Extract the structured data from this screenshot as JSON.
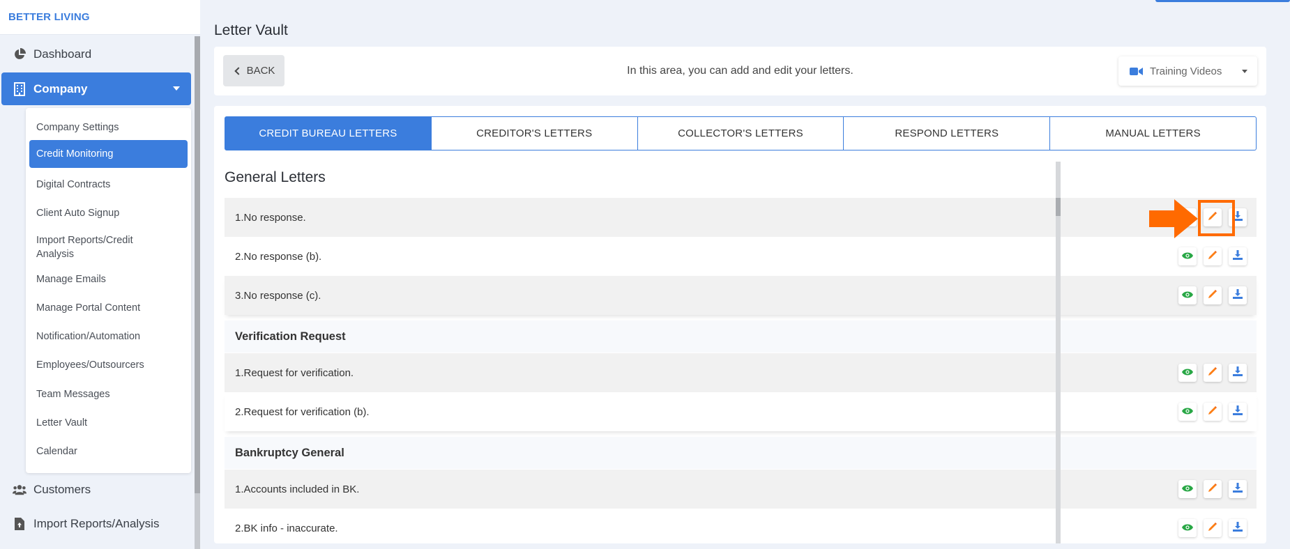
{
  "brand": "BETTER LIVING",
  "sidebar": {
    "dashboard": "Dashboard",
    "company": "Company",
    "submenu": [
      "Company Settings",
      "Credit Monitoring",
      "Digital Contracts",
      "Client Auto Signup",
      "Import Reports/Credit Analysis",
      "Manage Emails",
      "Manage Portal Content",
      "Notification/Automation",
      "Employees/Outsourcers",
      "Team Messages",
      "Letter Vault",
      "Calendar"
    ],
    "active_submenu": "Credit Monitoring",
    "customers": "Customers",
    "import": "Import Reports/Analysis"
  },
  "page": {
    "title": "Letter Vault",
    "back_label": "BACK",
    "description": "In this area, you can add and edit your letters.",
    "training_label": "Training Videos"
  },
  "tabs": [
    "CREDIT BUREAU LETTERS",
    "CREDITOR'S LETTERS",
    "COLLECTOR'S LETTERS",
    "RESPOND LETTERS",
    "MANUAL LETTERS"
  ],
  "active_tab": "CREDIT BUREAU LETTERS",
  "letters": {
    "section_title": "General Letters",
    "general": [
      "1.No response.",
      "2.No response (b).",
      "3.No response (c)."
    ],
    "verification_title": "Verification Request",
    "verification": [
      "1.Request for verification.",
      "2.Request for verification (b)."
    ],
    "bankruptcy_title": "Bankruptcy General",
    "bankruptcy": [
      "1.Accounts included in BK.",
      "2.BK info - inaccurate."
    ]
  },
  "colors": {
    "accent": "#3b7ddd",
    "view_icon": "#28a745",
    "edit_icon": "#fd7e14",
    "download_icon": "#3b7ddd",
    "highlight": "#ff6a00"
  },
  "icons": {
    "view": "eye-icon",
    "edit": "pencil-icon",
    "download": "download-icon"
  }
}
